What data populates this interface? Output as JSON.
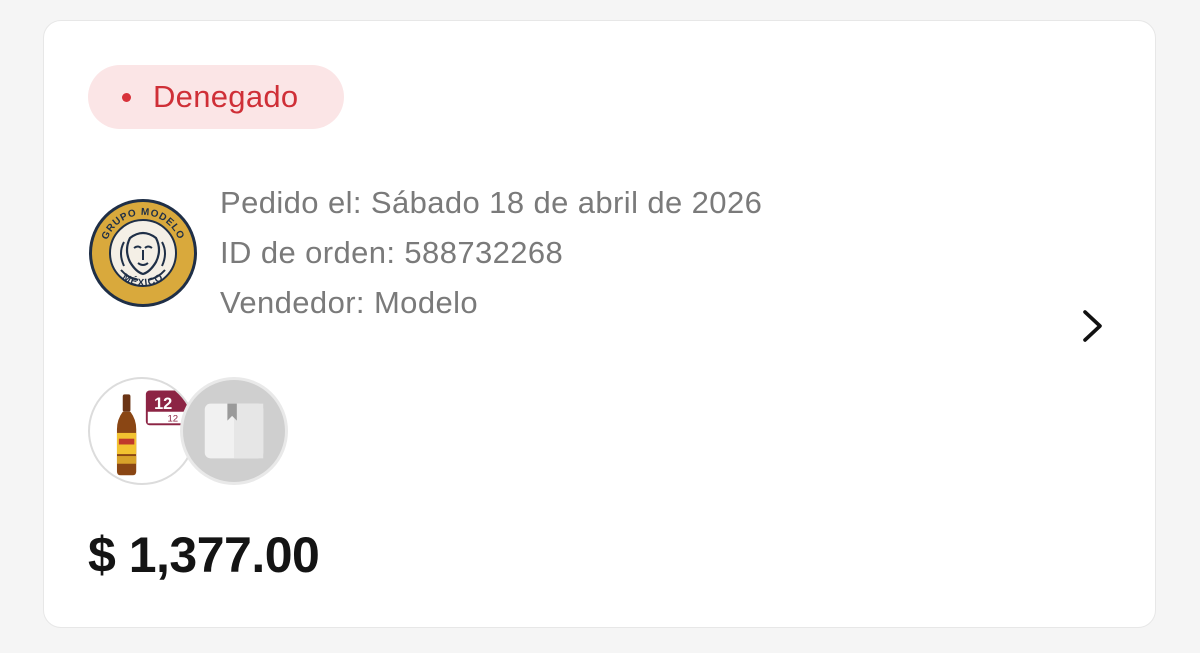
{
  "order": {
    "status": {
      "label": "Denegado",
      "color": "#d8323a",
      "background": "#fbe5e6"
    },
    "seller_logo": {
      "icon": "grupo-modelo-logo",
      "top_text": "GRUPO MODELO",
      "bottom_text": "MÉXICO"
    },
    "details": {
      "ordered_on": "Pedido el: Sábado 18 de abril de 2026",
      "order_id": "ID de orden: 588732268",
      "seller": "Vendedor: Modelo"
    },
    "chevron_icon": "chevron-right-icon",
    "products": [
      {
        "icon": "beer-bottle-product",
        "pack_label": "12"
      },
      {
        "icon": "placeholder-box-icon"
      }
    ],
    "total": "$ 1,377.00"
  }
}
